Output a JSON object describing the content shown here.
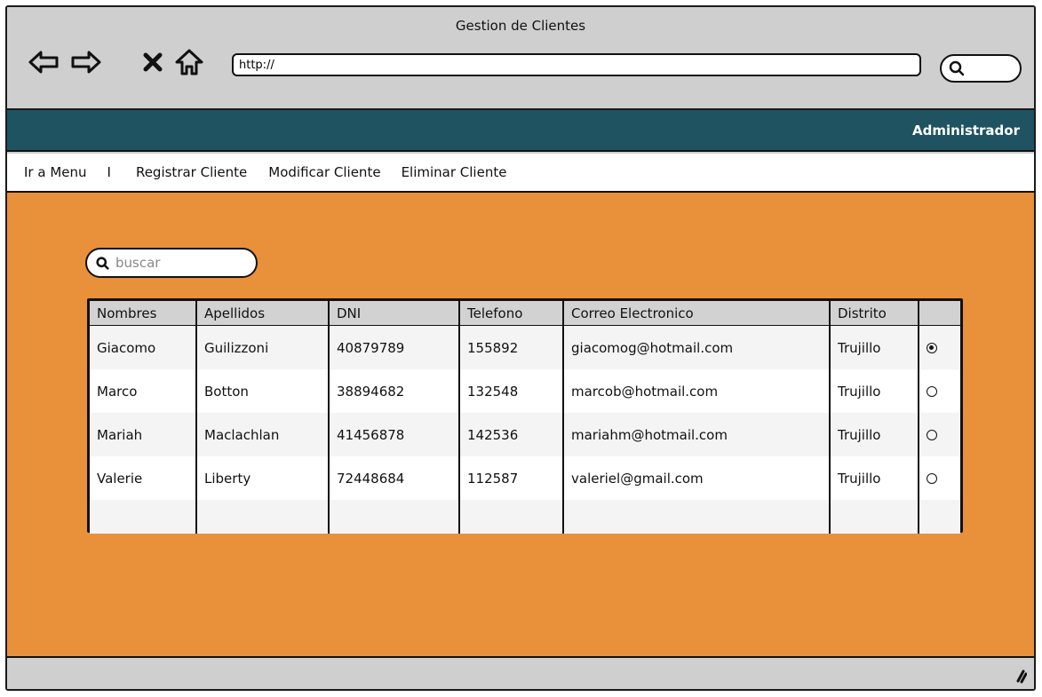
{
  "window": {
    "title": "Gestion de Clientes"
  },
  "toolbar": {
    "back_icon": "arrow-left-icon",
    "forward_icon": "arrow-right-icon",
    "stop_icon": "close-icon",
    "home_icon": "home-icon",
    "url": "http://",
    "search_icon": "search-icon"
  },
  "header": {
    "user": "Administrador"
  },
  "menu": {
    "go_menu": "Ir a Menu",
    "separator": "I",
    "items": [
      "Registrar Cliente",
      "Modificar Cliente",
      "Eliminar Cliente"
    ]
  },
  "search": {
    "placeholder": "buscar"
  },
  "table": {
    "columns": [
      "Nombres",
      "Apellidos",
      "DNI",
      "Telefono",
      "Correo Electronico",
      "Distrito",
      ""
    ],
    "rows": [
      {
        "nombres": "Giacomo",
        "apellidos": "Guilizzoni",
        "dni": "40879789",
        "telefono": "155892",
        "correo": "giacomog@hotmail.com",
        "distrito": "Trujillo",
        "selected": true
      },
      {
        "nombres": "Marco",
        "apellidos": "Botton",
        "dni": "38894682",
        "telefono": "132548",
        "correo": "marcob@hotmail.com",
        "distrito": "Trujillo",
        "selected": false
      },
      {
        "nombres": "Mariah",
        "apellidos": "Maclachlan",
        "dni": "41456878",
        "telefono": "142536",
        "correo": "mariahm@hotmail.com",
        "distrito": "Trujillo",
        "selected": false
      },
      {
        "nombres": "Valerie",
        "apellidos": "Liberty",
        "dni": "72448684",
        "telefono": "112587",
        "correo": "valeriel@gmail.com",
        "distrito": "Trujillo",
        "selected": false
      }
    ]
  },
  "colors": {
    "header_bar": "#1f5362",
    "content_bg": "#e8903a",
    "chrome": "#cfcfcf"
  }
}
